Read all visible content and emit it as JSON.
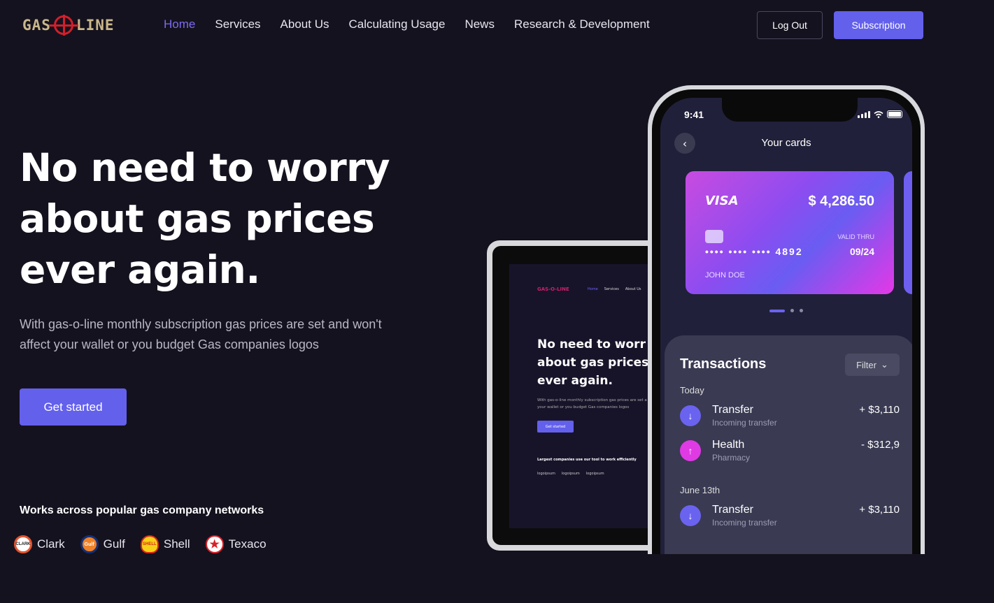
{
  "nav": {
    "logo_text_left": "GAS",
    "logo_text_right": "LINE",
    "items": [
      {
        "label": "Home",
        "active": true
      },
      {
        "label": "Services",
        "active": false
      },
      {
        "label": "About Us",
        "active": false
      },
      {
        "label": "Calculating Usage",
        "active": false
      },
      {
        "label": "News",
        "active": false
      },
      {
        "label": "Research & Development",
        "active": false
      }
    ],
    "logout_label": "Log Out",
    "subscription_label": "Subscription"
  },
  "hero": {
    "title_line1": "No need to worry",
    "title_line2": "about gas prices",
    "title_line3": "ever again.",
    "subtitle": "With gas-o-line monthly subscription gas prices are set and won't affect your wallet or you budget Gas companies logos",
    "cta_label": "Get started",
    "works_label": "Works across popular gas company networks",
    "companies": [
      {
        "name": "Clark",
        "icon": "clark-logo-icon"
      },
      {
        "name": "Gulf",
        "icon": "gulf-logo-icon"
      },
      {
        "name": "Shell",
        "icon": "shell-logo-icon"
      },
      {
        "name": "Texaco",
        "icon": "texaco-logo-icon"
      }
    ]
  },
  "tablet": {
    "logo": "GAS-O-LINE",
    "nav": [
      "Home",
      "Services",
      "About Us"
    ],
    "title_line1": "No need to worr",
    "title_line2": "about gas prices",
    "title_line3": "ever again.",
    "subtitle": "With gas-o-line monthly subscription gas prices are set a affect your wallet or you budget Gas companies logos",
    "cta_label": "Get started",
    "largest_label": "Largest companies use our tool to work efficiently",
    "logos": [
      "logoipsum",
      "logoipsum",
      "logoipsum"
    ]
  },
  "phone": {
    "time": "9:41",
    "screen_title": "Your cards",
    "card": {
      "brand": "VISA",
      "amount": "$ 4,286.50",
      "valid_label": "VALID THRU",
      "number": "•••• •••• •••• 4892",
      "expiry": "09/24",
      "holder": "JOHN DOE"
    },
    "transactions_title": "Transactions",
    "filter_label": "Filter",
    "groups": [
      {
        "label": "Today",
        "items": [
          {
            "name": "Transfer",
            "sub": "Incoming transfer",
            "amount": "+ $3,110",
            "type": "in"
          },
          {
            "name": "Health",
            "sub": "Pharmacy",
            "amount": "- $312,9",
            "type": "out"
          }
        ]
      },
      {
        "label": "June 13th",
        "items": [
          {
            "name": "Transfer",
            "sub": "Incoming transfer",
            "amount": "+ $3,110",
            "type": "in"
          }
        ]
      }
    ]
  },
  "colors": {
    "background": "#15121f",
    "accent": "#6360ec",
    "active_nav": "#7b6cf0"
  }
}
